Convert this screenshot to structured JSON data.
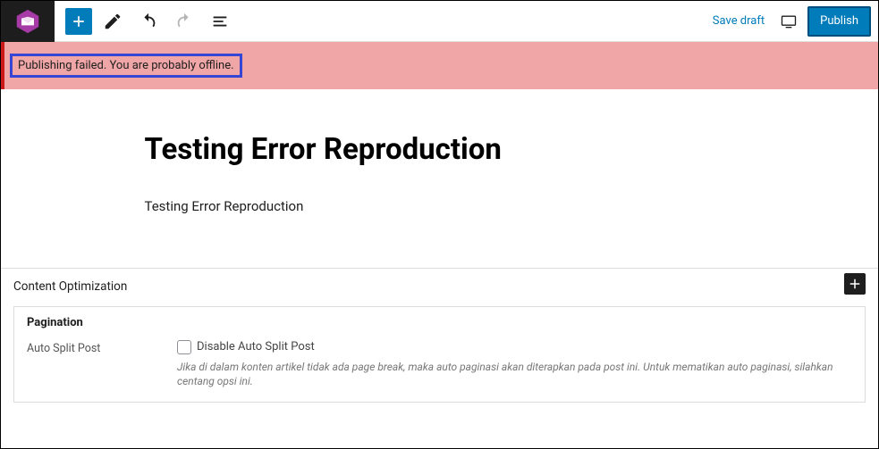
{
  "toolbar": {
    "save_draft_label": "Save draft",
    "publish_label": "Publish"
  },
  "error": {
    "message": "Publishing failed. You are probably offline."
  },
  "post": {
    "title": "Testing Error Reproduction",
    "body": "Testing Error Reproduction"
  },
  "meta": {
    "panel_title": "Content Optimization",
    "pagination": {
      "box_title": "Pagination",
      "field_label": "Auto Split Post",
      "checkbox_label": "Disable Auto Split Post",
      "description": "Jika di dalam konten artikel tidak ada page break, maka auto paginasi akan diterapkan pada post ini. Untuk mematikan auto paginasi, silahkan centang opsi ini."
    }
  },
  "icons": {
    "add": "plus-icon",
    "edit": "pencil-icon",
    "undo": "undo-icon",
    "redo": "redo-icon",
    "list": "list-view-icon",
    "view": "desktop-icon",
    "insert_block": "plus-icon"
  },
  "colors": {
    "primary": "#007cba",
    "error_bg": "#f0a6a6",
    "error_border": "#cc1818",
    "highlight_border": "#3745d4"
  }
}
